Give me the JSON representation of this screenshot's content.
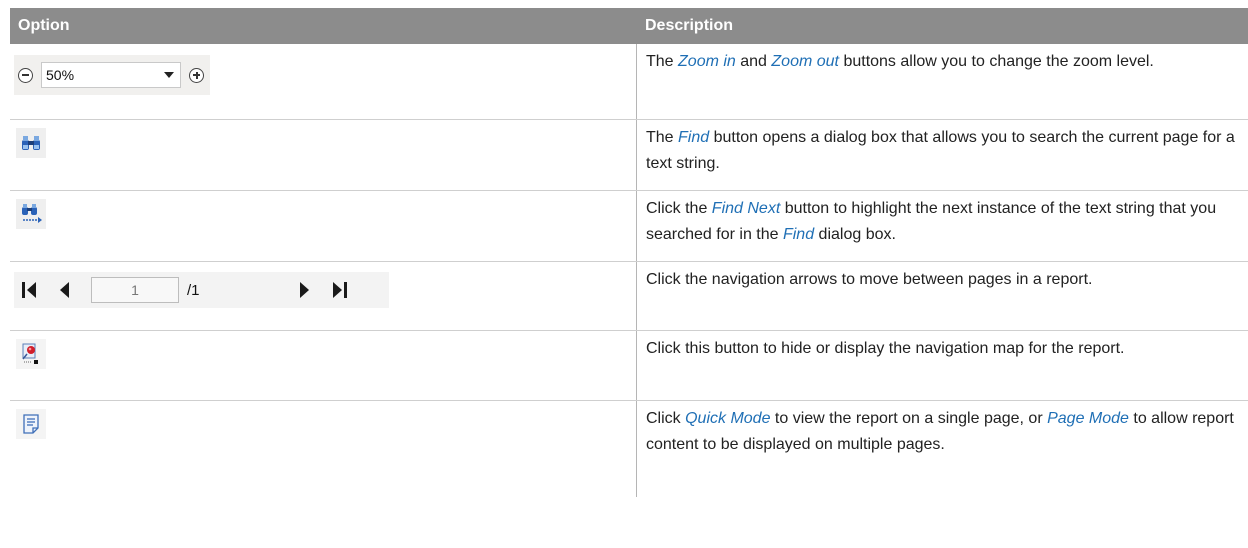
{
  "header": {
    "option": "Option",
    "description": "Description"
  },
  "rows": {
    "zoom": {
      "zoom_value": "50%",
      "desc": {
        "t1": "The ",
        "l1": "Zoom in",
        "t2": " and ",
        "l2": "Zoom out",
        "t3": " buttons allow you to change the zoom level."
      }
    },
    "find": {
      "desc": {
        "t1": "The ",
        "l1": "Find",
        "t2": " button opens a dialog box that allows you to search the current page for a text string."
      }
    },
    "find_next": {
      "desc": {
        "t1": "Click the ",
        "l1": "Find Next",
        "t2": " button to highlight the next instance of the text string that you searched for in the ",
        "l2": "Find",
        "t3": " dialog box."
      }
    },
    "navigation": {
      "page_value": "1",
      "page_total": "/1",
      "desc": "Click the navigation arrows to move between pages in a report."
    },
    "nav_map": {
      "desc": "Click this button to hide or display the navigation map for the report."
    },
    "mode": {
      "desc": {
        "t1": "Click ",
        "l1": "Quick Mode",
        "t2": " to view the report on a single page, or ",
        "l2": "Page Mode",
        "t3": " to allow report content to be displayed on multiple pages."
      }
    }
  },
  "icons": {
    "zoom_out": "zoom-out-icon",
    "zoom_in": "zoom-in-icon",
    "dropdown": "chevron-down-icon",
    "find": "binoculars-icon",
    "find_next": "binoculars-next-icon",
    "first_page": "first-page-icon",
    "prev_page": "previous-page-icon",
    "next_page": "next-page-icon",
    "last_page": "last-page-icon",
    "nav_map": "navigation-map-icon",
    "mode": "page-mode-icon"
  },
  "colors": {
    "header_bg": "#8c8c8c",
    "link": "#1f6fb5"
  }
}
